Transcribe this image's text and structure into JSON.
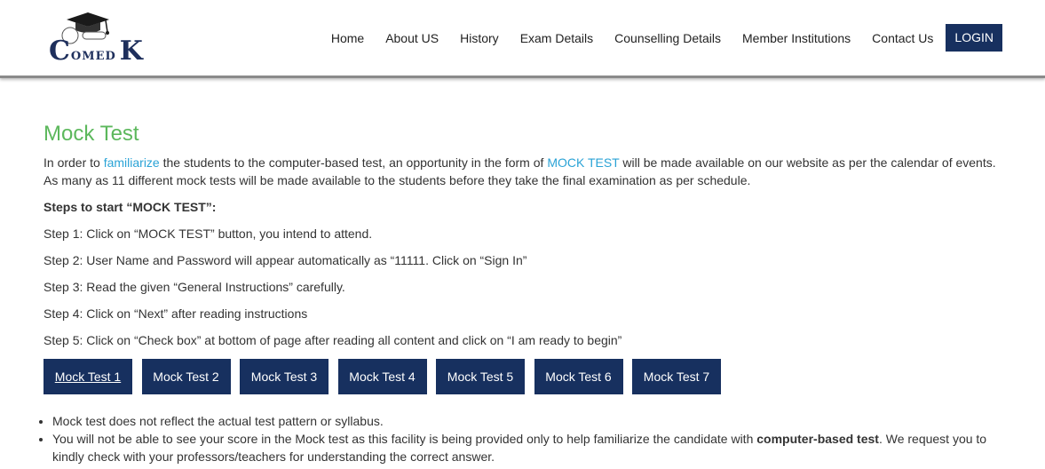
{
  "header": {
    "logo": {
      "c": "C",
      "omed": "OMED",
      "k": "K"
    },
    "nav": [
      "Home",
      "About US",
      "History",
      "Exam Details",
      "Counselling Details",
      "Member Institutions",
      "Contact Us"
    ],
    "login_label": "LOGIN"
  },
  "main": {
    "title": "Mock Test",
    "intro": {
      "p1": "In order to ",
      "link1": "familiarize",
      "p2": " the students to the computer-based test, an opportunity in the form of ",
      "link2": "MOCK TEST",
      "p3": " will be made available on our website as per the calendar of events. As many as 11 different mock tests will be made available to the students before they take the final examination as per schedule."
    },
    "steps_heading": "Steps to start “MOCK TEST”:",
    "steps": [
      "Step 1: Click on “MOCK TEST” button, you intend to attend.",
      "Step 2: User Name and Password will appear automatically as “11111. Click on “Sign In”",
      "Step 3: Read the given “General Instructions” carefully.",
      "Step 4: Click on “Next” after reading instructions",
      "Step 5: Click on “Check box” at bottom of page after reading all content and click on “I am ready to begin”"
    ],
    "mock_buttons": [
      "Mock Test 1",
      "Mock Test 2",
      "Mock Test 3",
      "Mock Test 4",
      "Mock Test 5",
      "Mock Test 6",
      "Mock Test 7"
    ],
    "notes": {
      "n1": "Mock test does not reflect the actual test pattern or syllabus.",
      "n2a": "You will not be able to see your score in the Mock test as this facility is being provided only to help familiarize the candidate with ",
      "n2b": "computer-based test",
      "n2c": ". We request you to kindly check with your professors/teachers for understanding the correct answer."
    }
  },
  "colors": {
    "title_green": "#5cb85c",
    "navy": "#17305f",
    "link_blue": "#2aa3d6"
  }
}
